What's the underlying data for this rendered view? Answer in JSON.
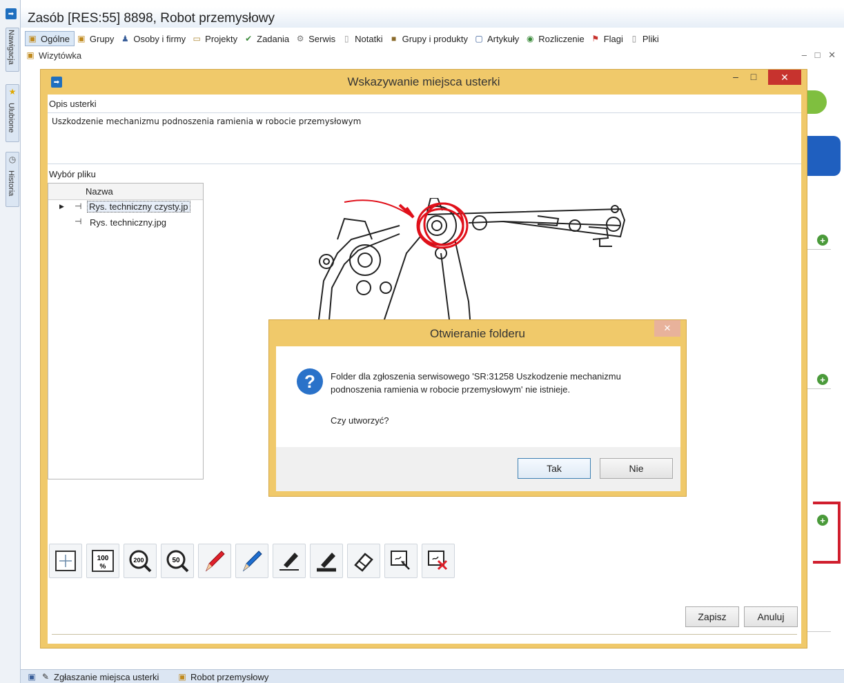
{
  "app": {
    "title": "Zasób [RES:55] 8898, Robot przemysłowy"
  },
  "side_tabs": [
    {
      "label": "Nawigacja"
    },
    {
      "label": "Ulubione"
    },
    {
      "label": "Historia"
    }
  ],
  "tabs": [
    {
      "label": "Ogólne",
      "icon": "card-icon"
    },
    {
      "label": "Grupy",
      "icon": "groups-icon"
    },
    {
      "label": "Osoby i firmy",
      "icon": "people-icon"
    },
    {
      "label": "Projekty",
      "icon": "folder-icon"
    },
    {
      "label": "Zadania",
      "icon": "tasks-icon"
    },
    {
      "label": "Serwis",
      "icon": "service-icon"
    },
    {
      "label": "Notatki",
      "icon": "note-icon"
    },
    {
      "label": "Grupy i produkty",
      "icon": "box-icon"
    },
    {
      "label": "Artykuły",
      "icon": "article-icon"
    },
    {
      "label": "Rozliczenie",
      "icon": "billing-icon"
    },
    {
      "label": "Flagi",
      "icon": "flag-icon"
    },
    {
      "label": "Pliki",
      "icon": "file-icon"
    }
  ],
  "subtab": {
    "label": "Wizytówka"
  },
  "dialog": {
    "title": "Wskazywanie miejsca usterki",
    "opis_label": "Opis usterki",
    "opis_text": "Uszkodzenie mechanizmu podnoszenia ramienia w robocie przemysłowym",
    "wybor_label": "Wybór pliku",
    "grid_header": "Nazwa",
    "files": [
      {
        "name": "Rys. techniczny czysty.jp",
        "selected": true
      },
      {
        "name": "Rys. techniczny.jpg",
        "selected": false
      }
    ],
    "tools": [
      {
        "icon": "fit-to-window-icon"
      },
      {
        "icon": "zoom-100-icon",
        "text": "100"
      },
      {
        "icon": "zoom-200-icon",
        "text": "200"
      },
      {
        "icon": "zoom-50-icon",
        "text": "50"
      },
      {
        "icon": "red-pen-icon"
      },
      {
        "icon": "blue-pen-icon"
      },
      {
        "icon": "marker-thin-icon"
      },
      {
        "icon": "marker-thick-icon"
      },
      {
        "icon": "eraser-icon"
      },
      {
        "icon": "select-area-icon"
      },
      {
        "icon": "clear-selection-icon"
      }
    ],
    "save_label": "Zapisz",
    "cancel_label": "Anuluj"
  },
  "msgbox": {
    "title": "Otwieranie folderu",
    "text": "Folder dla zgłoszenia serwisowego 'SR:31258 Uszkodzenie mechanizmu podnoszenia ramienia w robocie przemysłowym' nie istnieje.",
    "question": "Czy utworzyć?",
    "yes_label": "Tak",
    "no_label": "Nie"
  },
  "taskbar": [
    {
      "label": "Zgłaszanie miejsca usterki"
    },
    {
      "label": "Robot przemysłowy"
    }
  ],
  "colors": {
    "dialog_border": "#f0c96a",
    "close_red": "#c7332e",
    "annotation_red": "#e0101a",
    "accent_blue": "#1f6fbf",
    "plus_green": "#4a9a3a"
  }
}
